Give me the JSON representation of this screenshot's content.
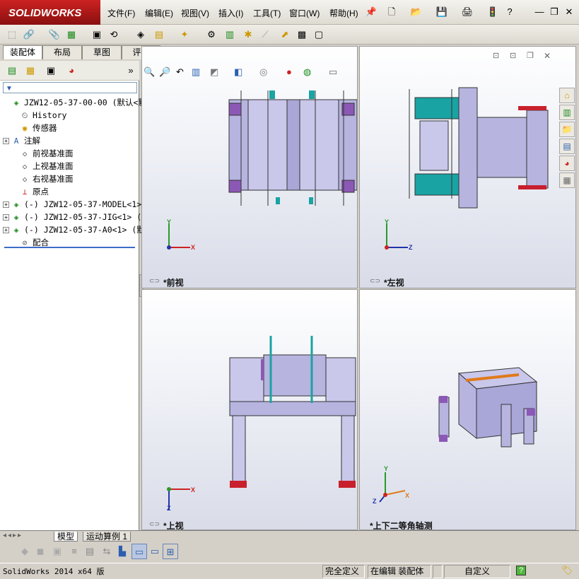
{
  "app": {
    "logo": "SOLIDWORKS"
  },
  "menu": [
    "文件(F)",
    "编辑(E)",
    "视图(V)",
    "插入(I)",
    "工具(T)",
    "窗口(W)",
    "帮助(H)"
  ],
  "quick_access_icons": [
    "pin-icon",
    "new-doc-icon",
    "open-icon",
    "save-icon",
    "print-icon",
    "rebuild-icon",
    "help-icon"
  ],
  "window_controls": [
    "minimize-icon",
    "restore-icon",
    "close-icon"
  ],
  "feature_tabs": [
    "装配体",
    "布局",
    "草图",
    "评估"
  ],
  "tree": [
    {
      "label": "JZW12-05-37-00-00  (默认<默认",
      "icon": "assembly-icon",
      "expand": false,
      "indent": 0
    },
    {
      "label": "History",
      "icon": "history-icon",
      "expand": false,
      "indent": 1
    },
    {
      "label": "传感器",
      "icon": "sensor-icon",
      "expand": false,
      "indent": 1
    },
    {
      "label": "注解",
      "icon": "annotation-icon",
      "expand": true,
      "indent": 1
    },
    {
      "label": "前视基准面",
      "icon": "plane-icon",
      "expand": false,
      "indent": 1
    },
    {
      "label": "上视基准面",
      "icon": "plane-icon",
      "expand": false,
      "indent": 1
    },
    {
      "label": "右视基准面",
      "icon": "plane-icon",
      "expand": false,
      "indent": 1
    },
    {
      "label": "原点",
      "icon": "origin-icon",
      "expand": false,
      "indent": 1
    },
    {
      "label": "(-) JZW12-05-37-MODEL<1>",
      "icon": "part-icon",
      "expand": true,
      "indent": 1
    },
    {
      "label": "(-) JZW12-05-37-JIG<1> (默",
      "icon": "part-icon",
      "expand": true,
      "indent": 1
    },
    {
      "label": "(-) JZW12-05-37-A0<1> (默",
      "icon": "part-icon",
      "expand": true,
      "indent": 1
    },
    {
      "label": "配合",
      "icon": "mate-icon",
      "expand": false,
      "indent": 1
    }
  ],
  "views": [
    {
      "label": "*前视",
      "axes": [
        "Y",
        "X"
      ]
    },
    {
      "label": "*左视",
      "axes": [
        "Y",
        "Z"
      ]
    },
    {
      "label": "*上视",
      "axes": [
        "Z",
        "X"
      ]
    },
    {
      "label": "*上下二等角轴测",
      "axes": [
        "Y",
        "X",
        "Z"
      ]
    }
  ],
  "bottom_tabs": [
    "模型",
    "运动算例 1"
  ],
  "status": {
    "app_version": "SolidWorks 2014 x64 版",
    "definition": "完全定义",
    "editing": "在编辑 装配体",
    "units": "自定义",
    "help": "?"
  },
  "colors": {
    "accent": "#c0141c",
    "part_purple": "#b7b4e0",
    "part_teal": "#1aa3a3",
    "part_red": "#c8202c"
  }
}
